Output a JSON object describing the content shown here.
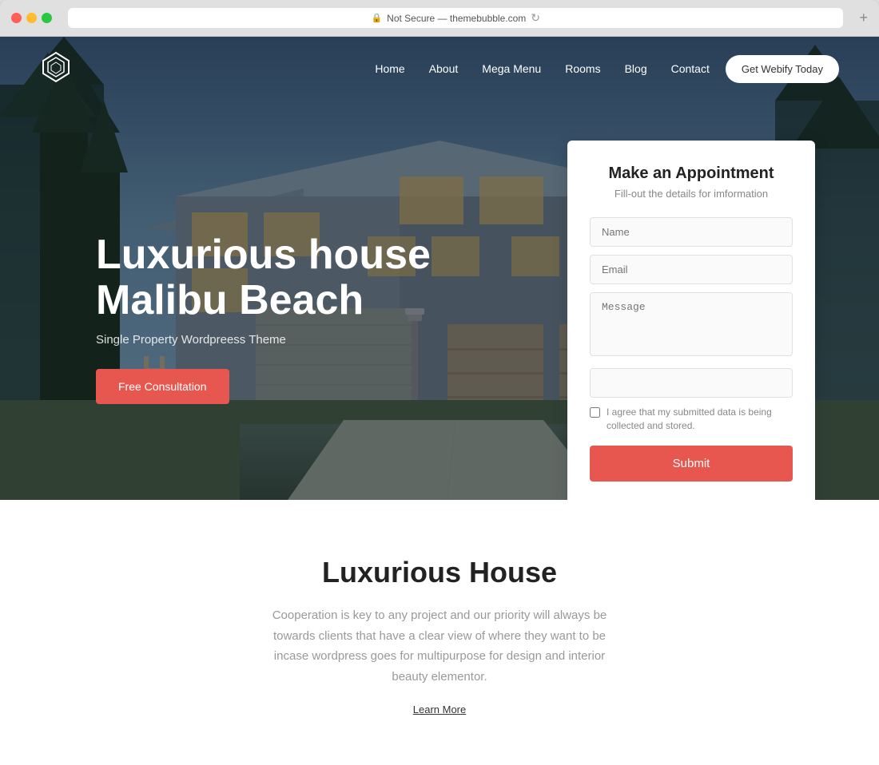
{
  "browser": {
    "url": "Not Secure — themebubble.com",
    "new_tab_label": "+"
  },
  "navbar": {
    "logo_alt": "Logo",
    "links": [
      {
        "label": "Home",
        "href": "#"
      },
      {
        "label": "About",
        "href": "#"
      },
      {
        "label": "Mega Menu",
        "href": "#"
      },
      {
        "label": "Rooms",
        "href": "#"
      },
      {
        "label": "Blog",
        "href": "#"
      },
      {
        "label": "Contact",
        "href": "#"
      }
    ],
    "cta_label": "Get Webify Today"
  },
  "hero": {
    "title_line1": "Luxurious house",
    "title_line2": "Malibu Beach",
    "subtitle": "Single Property Wordpreess Theme",
    "btn_label": "Free Consultation"
  },
  "appointment_form": {
    "title": "Make an Appointment",
    "subtitle": "Fill-out the details for imformation",
    "name_placeholder": "Name",
    "email_placeholder": "Email",
    "message_placeholder": "Message",
    "select_placeholder": "",
    "checkbox_label": "I agree that my submitted data is being collected and stored.",
    "submit_label": "Submit"
  },
  "lower_section": {
    "title": "Luxurious House",
    "description": "Cooperation is key to any project and our priority will always be towards clients that have a clear view of where they want to be incase wordpress goes for multipurpose for design and interior beauty elementor.",
    "learn_more_label": "Learn More"
  }
}
